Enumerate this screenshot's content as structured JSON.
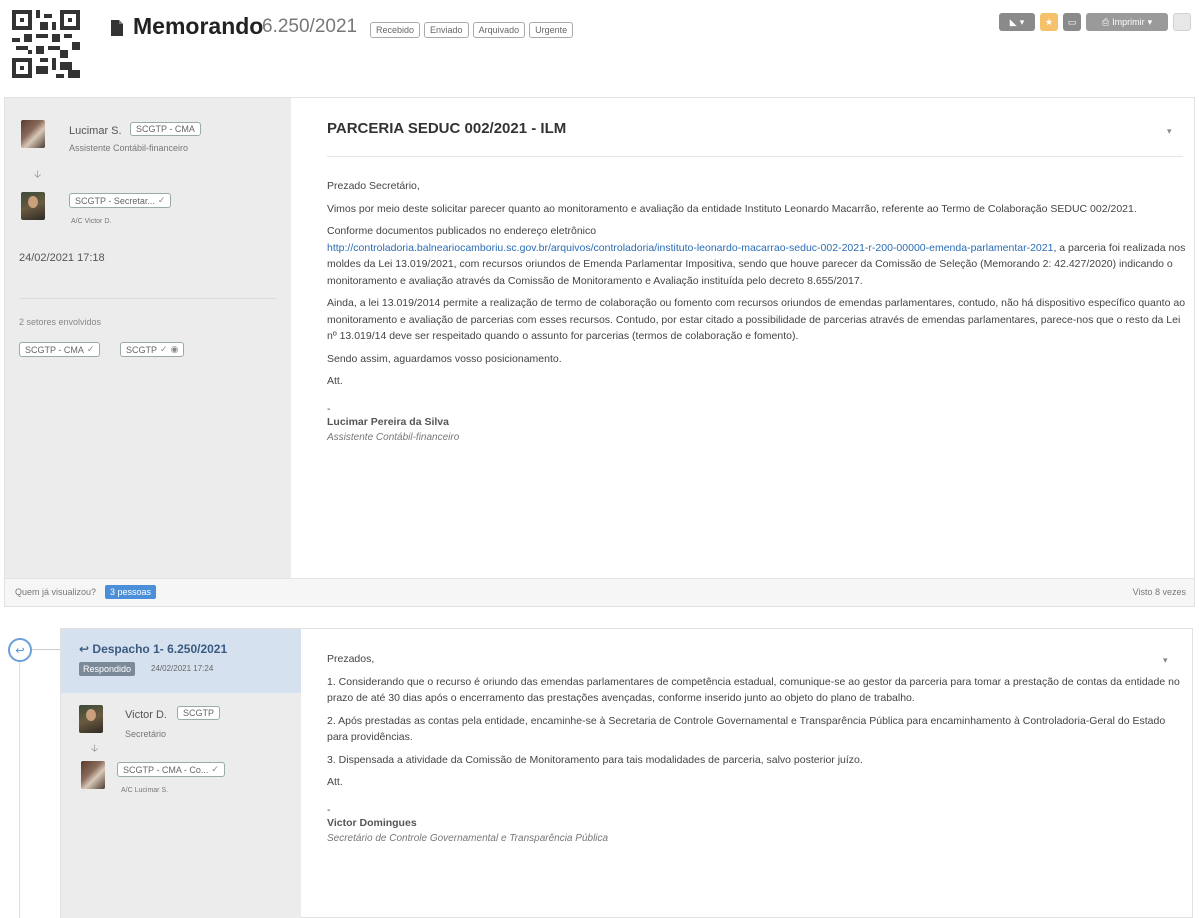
{
  "header": {
    "title": "Memorando",
    "number": "6.250/2021",
    "tags": [
      "Recebido",
      "Enviado",
      "Arquivado",
      "Urgente"
    ],
    "print_label": "Imprimir"
  },
  "document": {
    "sender": {
      "name": "Lucimar S.",
      "unit": "SCGTP - CMA",
      "role": "Assistente Contábil-financeiro"
    },
    "recipient": {
      "unit": "SCGTP - Secretar...",
      "ac": "A/C Victor D."
    },
    "date": "24/02/2021 17:18",
    "sectors_title": "2 setores envolvidos",
    "sectors": [
      "SCGTP - CMA",
      "SCGTP"
    ],
    "title": "PARCERIA SEDUC 002/2021 - ILM",
    "greeting": "Prezado Secretário,",
    "p1": "Vimos por meio deste solicitar parecer quanto ao monitoramento e avaliação da entidade Instituto Leonardo Macarrão, referente ao Termo de Colaboração SEDUC 002/2021.",
    "p2_intro": "Conforme documentos publicados no endereço eletrônico",
    "p2_link": "http://controladoria.balneariocamboriu.sc.gov.br/arquivos/controladoria/instituto-leonardo-macarrao-seduc-002-2021-r-200-00000-emenda-parlamentar-2021",
    "p2_rest": ", a parceria foi realizada nos moldes da Lei 13.019/2021, com recursos oriundos de Emenda Parlamentar Impositiva, sendo que houve parecer da Comissão de Seleção (Memorando 2: 42.427/2020) indicando o monitoramento e avaliação através da Comissão de Monitoramento e Avaliação instituída pelo decreto 8.655/2017.",
    "p3": "Ainda, a lei 13.019/2014 permite a realização de termo de colaboração ou fomento com recursos oriundos de emendas parlamentares, contudo, não há dispositivo específico quanto ao monitoramento e avaliação de parcerias com esses recursos. Contudo, por estar citado a possibilidade de parcerias através de emendas parlamentares, parece-nos que o resto da Lei nº 13.019/14 deve ser respeitado quando o assunto for parcerias (termos de colaboração e fomento).",
    "p4": "Sendo assim, aguardamos vosso posicionamento.",
    "closing": "Att.",
    "dash": "-",
    "signature_name": "Lucimar Pereira da Silva",
    "signature_role": "Assistente Contábil-financeiro",
    "footer_question": "Quem já visualizou?",
    "footer_badge": "3 pessoas",
    "footer_seen": "Visto 8 vezes"
  },
  "dispatch": {
    "title": "Despacho 1- 6.250/2021",
    "status": "Respondido",
    "date": "24/02/2021 17:24",
    "sender": {
      "name": "Victor D.",
      "unit": "SCGTP",
      "role": "Secretário"
    },
    "recipient": {
      "unit": "SCGTP - CMA - Co...",
      "ac": "A/C Lucimar S."
    },
    "greeting": "Prezados,",
    "i1": "1. Considerando que o recurso é oriundo das emendas parlamentares de competência estadual, comunique-se ao gestor da parceria para tomar a prestação de contas da entidade no prazo de até 30 dias após o encerramento das prestações avençadas, conforme inserido junto ao objeto do plano de trabalho.",
    "i2": "2. Após prestadas as contas pela entidade, encaminhe-se à Secretaria de Controle Governamental e Transparência Pública para encaminhamento à Controladoria-Geral do Estado para providências.",
    "i3": "3. Dispensada a atividade da Comissão de Monitoramento para tais modalidades de parceria, salvo posterior juízo.",
    "closing": "Att.",
    "dash": "-",
    "signature_name": "Victor Domingues",
    "signature_role": "Secretário de Controle Governamental e Transparência Pública"
  }
}
